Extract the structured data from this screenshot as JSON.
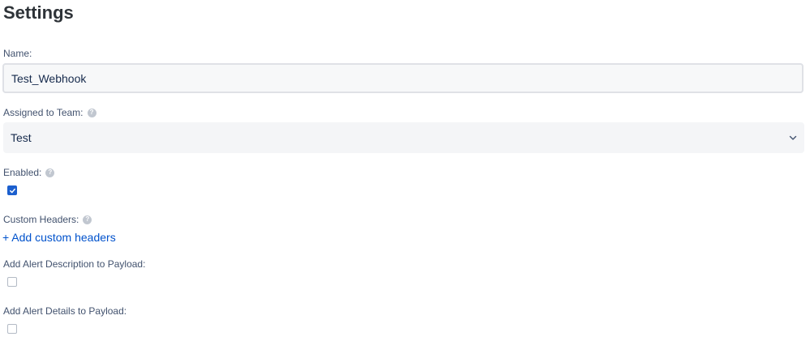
{
  "page": {
    "title": "Settings"
  },
  "name_field": {
    "label": "Name:",
    "value": "Test_Webhook"
  },
  "team_field": {
    "label": "Assigned to Team:",
    "selected": "Test"
  },
  "enabled_field": {
    "label": "Enabled:",
    "checked": true
  },
  "custom_headers": {
    "label": "Custom Headers:",
    "add_link": "+ Add custom headers"
  },
  "alert_description": {
    "label": "Add Alert Description to Payload:",
    "checked": false
  },
  "alert_details": {
    "label": "Add Alert Details to Payload:",
    "checked": false
  },
  "colors": {
    "link": "#0052cc",
    "checkbox_checked": "#1b5fce",
    "help_icon": "#c1c7d0"
  },
  "icons": [
    "help-icon",
    "chevron-down-icon",
    "checkmark-icon"
  ]
}
